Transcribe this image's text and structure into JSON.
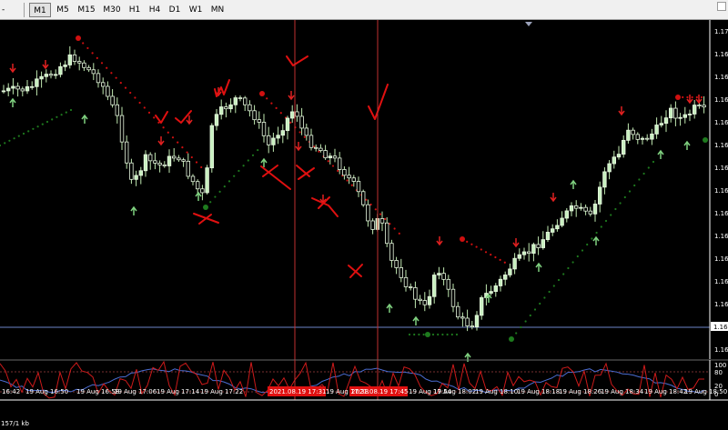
{
  "toolbar": {
    "left_label": "-",
    "timeframes": [
      "M1",
      "M5",
      "M15",
      "M30",
      "H1",
      "H4",
      "D1",
      "W1",
      "MN"
    ],
    "active": "M1"
  },
  "price_axis": {
    "labels": [
      "1.17",
      "1.16",
      "1.16",
      "1.16",
      "1.16",
      "1.16",
      "1.16",
      "1.16",
      "1.16",
      "1.16",
      "1.16",
      "1.16",
      "1.16",
      "1.16",
      "1.16"
    ],
    "current_price_box": "1.16"
  },
  "oscillator": {
    "levels": [
      "100",
      "80",
      "20",
      "0"
    ]
  },
  "time_axis": {
    "labels": [
      "16:42",
      "19 Aug 16:50",
      "19 Aug 16:58",
      "19 Aug 17:06",
      "19 Aug 17:14",
      "19 Aug 17:22",
      "19 Aug 17:30",
      "19 Aug 17:38",
      "19 Aug 17:46",
      "19 Aug 17:54",
      "19 Aug 18:02",
      "19 Aug 18:10",
      "19 Aug 18:18",
      "19 Aug 18:26",
      "19 Aug 18:34",
      "19 Aug 18:42",
      "19 Aug 18:50"
    ],
    "highlight_1": "2021.08.19 17:31",
    "highlight_2": "2021.08.19 17:45"
  },
  "status": "157/1 kb",
  "colors": {
    "bull": "#c8f0c0",
    "bear": "#e8f8e0",
    "wick": "#bfe8b0",
    "sar_up": "#1e7a1e",
    "sar_down": "#d01010",
    "arrow_up": "#7fd07f",
    "arrow_down": "#e02020",
    "annotation": "#e01010",
    "osc1": "#cc1a1a",
    "osc2": "#4a6cd0",
    "vline": "#c03030",
    "hline": "#6d83c8"
  }
}
